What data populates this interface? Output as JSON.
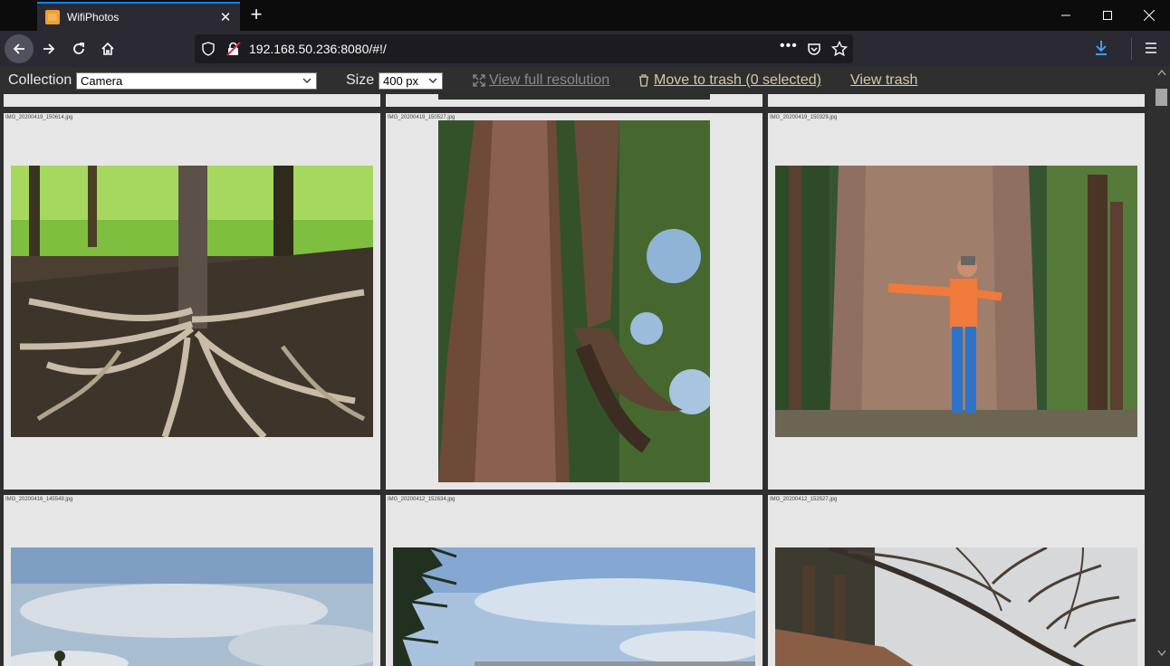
{
  "browser": {
    "tab_title": "WifiPhotos",
    "url": "192.168.50.236:8080/#!/",
    "url_more": "•••"
  },
  "toolbar": {
    "collection_label": "Collection",
    "collection_value": "Camera",
    "size_label": "Size",
    "size_value": "400 px",
    "view_full_resolution": "View full resolution",
    "move_to_trash": "Move to trash (0 selected)",
    "view_trash": "View trash"
  },
  "photos": [
    {
      "name": "IMG_20200419_150614.jpg",
      "subject": "tree-roots-on-hillside"
    },
    {
      "name": "IMG_20200419_150527.jpg",
      "subject": "tall-redwood-trunks"
    },
    {
      "name": "IMG_20200419_150329.jpg",
      "subject": "person-hugging-redwood"
    },
    {
      "name": "IMG_20200416_145549.jpg",
      "subject": "cloudy-sky"
    },
    {
      "name": "IMG_20200412_152634.jpg",
      "subject": "sky-over-bay"
    },
    {
      "name": "IMG_20200412_152527.jpg",
      "subject": "cypress-trees"
    }
  ]
}
